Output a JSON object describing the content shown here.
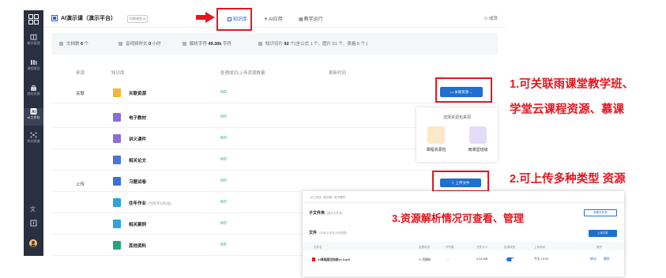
{
  "sidebar": {
    "items": [
      {
        "label": "教学管理",
        "icon": "book-icon"
      },
      {
        "label": "课程建设",
        "icon": "library-icon"
      },
      {
        "label": "我的资源",
        "icon": "bag-icon"
      },
      {
        "label": "AI工作台",
        "icon": "ai-icon"
      },
      {
        "label": "知识图谱",
        "icon": "graph-icon"
      }
    ],
    "bottom_icons": [
      "translate-icon",
      "export-icon",
      "user-avatar"
    ]
  },
  "header": {
    "title": "AI演示课（演示平台）",
    "switch_label": "切换课程 ⇄",
    "tabs": [
      "知识库",
      "AI应用",
      "教学运行"
    ],
    "member": "成员"
  },
  "stats": [
    {
      "label": "文档数",
      "value": "6",
      "unit": "个"
    },
    {
      "label": "音视频时长",
      "value": "0",
      "unit": "小时"
    },
    {
      "label": "解析字符",
      "value": "49.30k",
      "unit": "字符"
    },
    {
      "label": "知识切片",
      "value": "92",
      "unit": "个(含公式 1 个、图片 51 个、表格 6 个 )"
    }
  ],
  "table": {
    "headers": [
      "来源",
      "知识库",
      "处理成功/上传资源数量",
      "更新时间"
    ],
    "source_link": "关联",
    "source_upload": "上传",
    "rows": [
      {
        "name": "关联资源",
        "count": "0/0",
        "color": "#f3b53a"
      },
      {
        "name": "电子教材",
        "count": "0/0",
        "color": "#8b6fd6"
      },
      {
        "name": "讲义课件",
        "count": "0/0",
        "color": "#8b6fd6"
      },
      {
        "name": "相关论文",
        "count": "0/0",
        "color": "#4f74d9"
      },
      {
        "name": "习题试卷",
        "count": "0/0",
        "color": "#3a6ed8"
      },
      {
        "name": "往年作业",
        "note": "(包括评分标准)",
        "count": "0/0",
        "color": "#2fa4d9"
      },
      {
        "name": "相关案例",
        "count": "0/0",
        "color": "#2fa4d9"
      },
      {
        "name": "其他资料",
        "count": "6/6",
        "color": "#2aa37a"
      }
    ]
  },
  "buttons": {
    "link_resource": "关联资源 ⌄",
    "upload_file": "上传文件"
  },
  "popover": {
    "title": "选择资源包来源",
    "options": [
      "课程资源包",
      "雨课堂班级"
    ]
  },
  "annotations": [
    "1.可关联雨课堂教学班、",
    "学堂云课程资源、慕课",
    "2.可上传多种类型 资源",
    "3.资源解析情况可查看、管理"
  ],
  "overlay": {
    "breadcrumb": "AI工作台  /  知识库  /  电子教材",
    "subfolder_title": "子文件夹",
    "subfolder_note": "(暂无文件夹)",
    "new_folder": "新建文件夹",
    "files_title": "文件",
    "files_note": "(手动/从本地上传资源)",
    "upload": "上传文件",
    "headers": [
      "文件名",
      "处理状态",
      "字符数",
      "文件大小",
      "启用状态",
      "上传时间",
      "操作"
    ],
    "file": {
      "name": "AI课程建设指南v1.0.pdf",
      "status": "① 切解析",
      "chars": "--",
      "size": "2.44 MB",
      "time": "今天 10:00",
      "actions": [
        "移动",
        "删除"
      ]
    }
  },
  "colors": {
    "accent": "#1f6fd1",
    "annotation": "#e4161f",
    "sidebar": "#2b3040"
  }
}
